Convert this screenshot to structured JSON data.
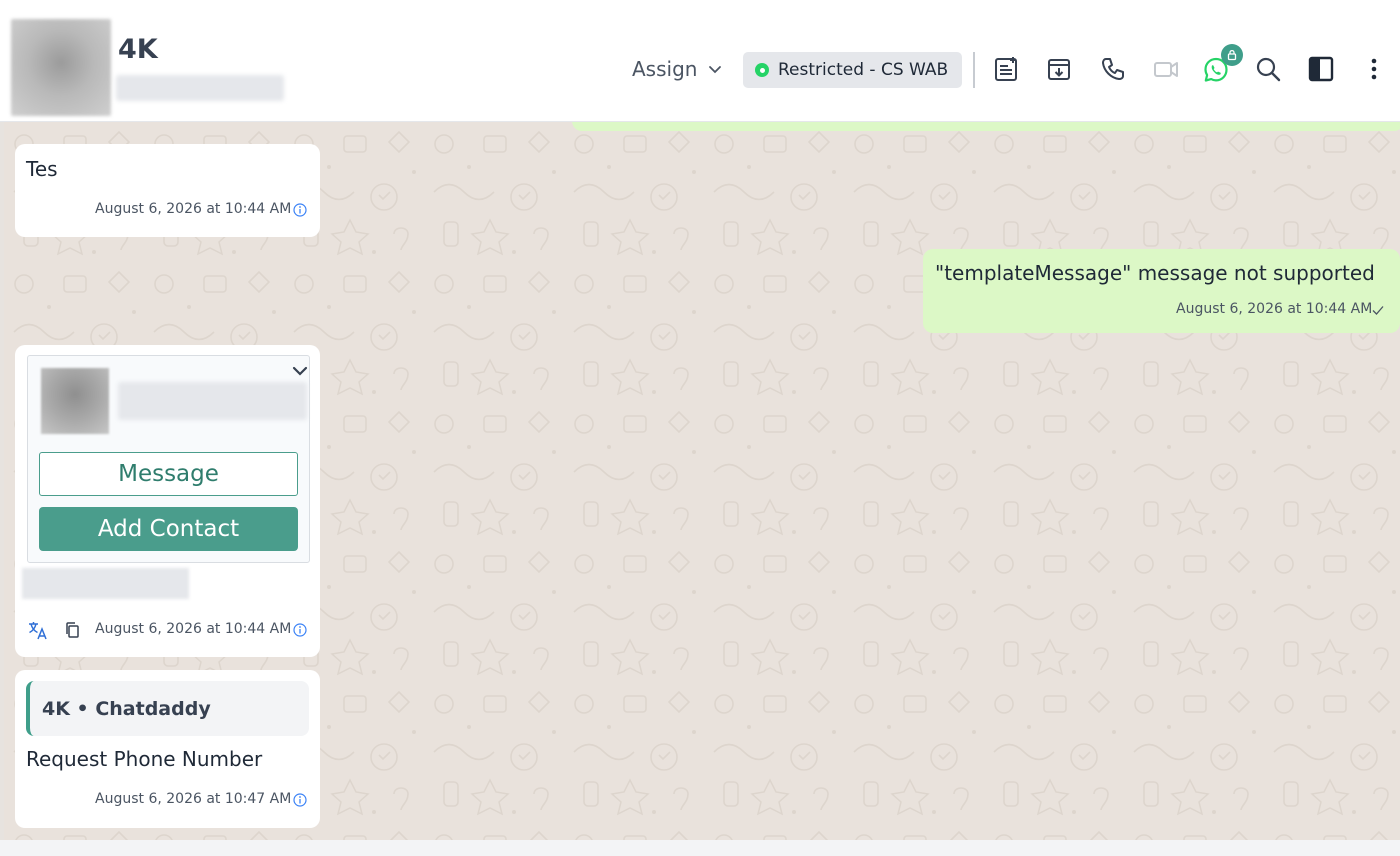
{
  "header": {
    "contact_name": "4K",
    "assign_label": "Assign",
    "restricted_label": "Restricted - CS WAB",
    "colors": {
      "accent": "#4a9d8c",
      "whatsapp": "#25d366",
      "outgoing_bubble": "#dcf8c6",
      "chat_bg": "#e9e2dc"
    },
    "icons": [
      "notes-icon",
      "archive-download-icon",
      "phone-icon",
      "video-icon",
      "whatsapp-icon",
      "lock-icon",
      "search-icon",
      "sidebar-toggle-icon",
      "more-vertical-icon"
    ]
  },
  "messages": [
    {
      "direction": "incoming",
      "text": "Tes",
      "timestamp": "August 6, 2026 at 10:44 AM"
    },
    {
      "direction": "outgoing",
      "text": "\"templateMessage\" message not supported",
      "timestamp": "August 6, 2026 at 10:44 AM",
      "status": "sent"
    },
    {
      "direction": "incoming",
      "type": "contact-card",
      "message_button": "Message",
      "add_contact_button": "Add Contact",
      "timestamp": "August 6, 2026 at 10:44 AM"
    },
    {
      "direction": "incoming",
      "quote": "4K • Chatdaddy",
      "text": "Request Phone Number",
      "timestamp": "August 6, 2026 at 10:47 AM"
    }
  ]
}
